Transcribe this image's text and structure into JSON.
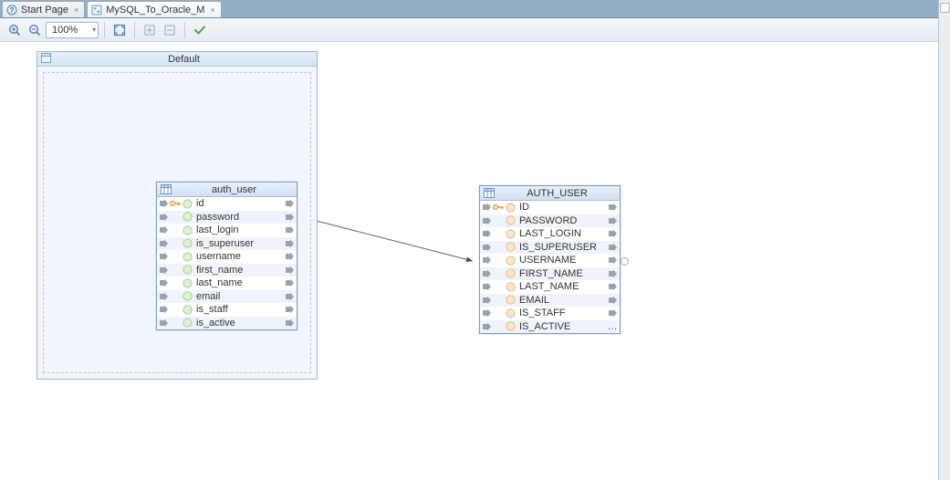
{
  "tabs": {
    "start": "Start Page",
    "doc": "MySQL_To_Oracle_M"
  },
  "toolbar": {
    "zoom_value": "100%"
  },
  "group": {
    "title": "Default"
  },
  "source_table": {
    "title": "auth_user",
    "columns": [
      {
        "name": "id",
        "pk": true
      },
      {
        "name": "password",
        "pk": false
      },
      {
        "name": "last_login",
        "pk": false
      },
      {
        "name": "is_superuser",
        "pk": false
      },
      {
        "name": "username",
        "pk": false
      },
      {
        "name": "first_name",
        "pk": false
      },
      {
        "name": "last_name",
        "pk": false
      },
      {
        "name": "email",
        "pk": false
      },
      {
        "name": "is_staff",
        "pk": false
      },
      {
        "name": "is_active",
        "pk": false
      }
    ]
  },
  "target_table": {
    "title": "AUTH_USER",
    "columns": [
      {
        "name": "ID",
        "pk": true
      },
      {
        "name": "PASSWORD",
        "pk": false
      },
      {
        "name": "LAST_LOGIN",
        "pk": false
      },
      {
        "name": "IS_SUPERUSER",
        "pk": false
      },
      {
        "name": "USERNAME",
        "pk": false
      },
      {
        "name": "FIRST_NAME",
        "pk": false
      },
      {
        "name": "LAST_NAME",
        "pk": false
      },
      {
        "name": "EMAIL",
        "pk": false
      },
      {
        "name": "IS_STAFF",
        "pk": false
      },
      {
        "name": "IS_ACTIVE",
        "pk": false
      }
    ],
    "show_ellipsis_on_last": true
  }
}
